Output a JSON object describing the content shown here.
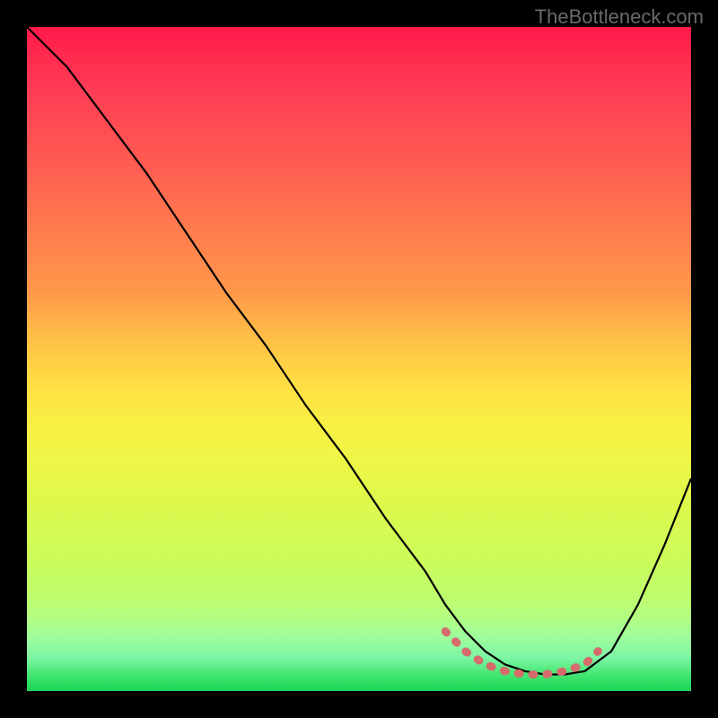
{
  "watermark": "TheBottleneck.com",
  "chart_data": {
    "type": "line",
    "title": "",
    "xlabel": "",
    "ylabel": "",
    "xlim": [
      0,
      100
    ],
    "ylim": [
      0,
      100
    ],
    "grid": false,
    "series": [
      {
        "name": "bottleneck-curve",
        "x": [
          0,
          6,
          12,
          18,
          24,
          30,
          36,
          42,
          48,
          54,
          60,
          63,
          66,
          69,
          72,
          75,
          78,
          81,
          84,
          88,
          92,
          96,
          100
        ],
        "y": [
          100,
          94,
          86,
          78,
          69,
          60,
          52,
          43,
          35,
          26,
          18,
          13,
          9,
          6,
          4,
          3,
          2.5,
          2.5,
          3,
          6,
          13,
          22,
          32
        ],
        "color": "#000000",
        "width": 2.2
      },
      {
        "name": "optimal-band",
        "x": [
          63,
          66,
          69,
          72,
          75,
          78,
          81,
          84,
          86
        ],
        "y": [
          9,
          6,
          4,
          3,
          2.5,
          2.5,
          3,
          4,
          6
        ],
        "color": "#d66b6b",
        "width": 9,
        "dotted": true
      }
    ],
    "gradient_stops": [
      {
        "pos": 0,
        "color": "#ff1a4a"
      },
      {
        "pos": 50,
        "color": "#ffe244"
      },
      {
        "pos": 100,
        "color": "#1ed455"
      }
    ]
  }
}
